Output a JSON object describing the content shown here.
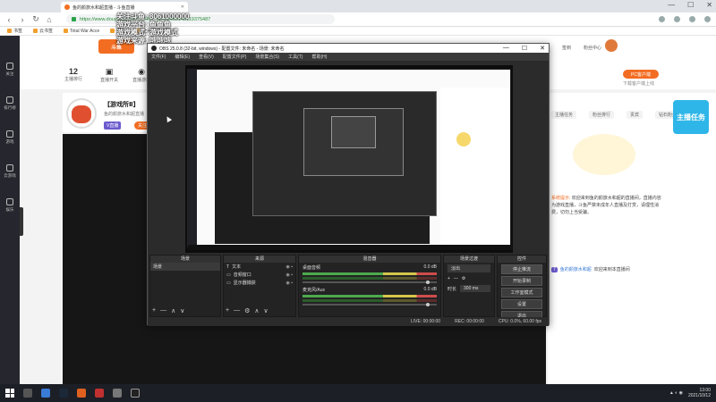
{
  "browser": {
    "tab_title": "鱼的颜旅水和超直播 - 斗鱼直播",
    "url": "https://www.douyu.com/3797946?_rii=0.6469146119375487",
    "bookmarks": [
      "书签",
      "云书签",
      "Total War Acce",
      "网游",
      "全民行直_娱乐体",
      "斗鱼"
    ],
    "window_controls": [
      "—",
      "☐",
      "✕"
    ]
  },
  "overlay_text": [
    "关注斗鱼: 8061000000",
    "游戏平台: 鱼鱼鱼",
    "游戏模式: 游戏模式",
    "游戏来源: 哦哦哦"
  ],
  "page": {
    "sidebar": [
      "关注",
      "排行榜",
      "游戏",
      "云游戏",
      "娱乐"
    ],
    "nav_stats": [
      {
        "num": "12",
        "label": "主播排行"
      },
      {
        "num": "",
        "label": "直播开关"
      },
      {
        "num": "",
        "label": "直播游戏"
      }
    ],
    "top_buttons": [
      "直播",
      "下载",
      "签到",
      "粉丝中心"
    ],
    "pc_button": "PC客户端",
    "pc_sub": "下载客户端上线",
    "room_title": "【游戏所Ⅱ】",
    "room_sub": "鱼的颜旅水和超直播",
    "v_badge": "V直播",
    "follow_btn": "关注",
    "right_tabs": [
      "主播任务",
      "粉丝排行",
      "贵宾",
      "钻石粉丝"
    ],
    "banner": "主播任务",
    "chat_lines": [
      {
        "user": "系统提示:",
        "text": "欢迎来到鱼的颜旅水和超的直播间，直播内容为游戏直播，斗鱼严禁未成年人直播及打赏，请理性消费，切勿上当受骗。"
      },
      {
        "user": "",
        "text": "欢迎来到本直播间"
      }
    ],
    "chat_badge": "7",
    "chat_user": "鱼的颜旅水和超"
  },
  "obs": {
    "title": "OBS 25.0.8 (32-bit, windows) - 配置文件: 未命名 - 场景: 未命名",
    "menu": [
      "文件(F)",
      "编辑(E)",
      "查看(V)",
      "配置文件(P)",
      "场景集合(S)",
      "工具(T)",
      "帮助(H)"
    ],
    "docks": {
      "scenes": {
        "title": "场景",
        "items": [
          "场景"
        ]
      },
      "sources": {
        "title": "来源",
        "items": [
          "文本",
          "音频窗口",
          "显示器捕获"
        ]
      },
      "mixer": {
        "title": "混音器",
        "channels": [
          {
            "name": "桌面音频",
            "db": "0.0 dB"
          },
          {
            "name": "麦克风/Aux",
            "db": "0.0 dB"
          }
        ]
      },
      "transitions": {
        "title": "场景过渡",
        "mode": "淡出",
        "duration_label": "时长",
        "duration": "300 ms"
      },
      "controls": {
        "title": "控件",
        "buttons": [
          "停止推流",
          "开始录制",
          "工作室模式",
          "设置",
          "退出"
        ]
      }
    },
    "status": [
      "LIVE: 00:00:00",
      "REC: 00:00:00",
      "CPU: 0.0%, 60.00 fps"
    ],
    "dock_footer": [
      "+",
      "—",
      "∧",
      "∨"
    ]
  },
  "taskbar": {
    "time": "13:00",
    "date": "2021/10/12"
  }
}
